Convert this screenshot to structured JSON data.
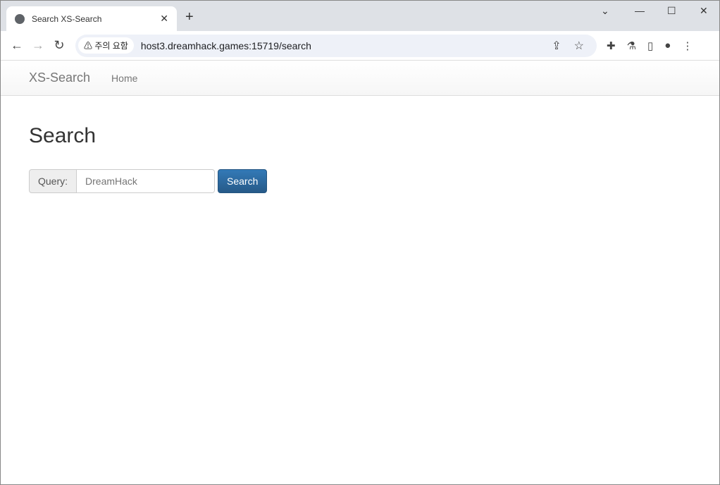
{
  "browser": {
    "tab_title": "Search XS-Search",
    "warning": "⚠ 주의 요함",
    "url": "host3.dreamhack.games:15719/search"
  },
  "navbar": {
    "brand": "XS-Search",
    "home": "Home"
  },
  "main": {
    "title": "Search",
    "query_label": "Query:",
    "query_placeholder": "DreamHack",
    "query_value": "",
    "search_button": "Search"
  }
}
